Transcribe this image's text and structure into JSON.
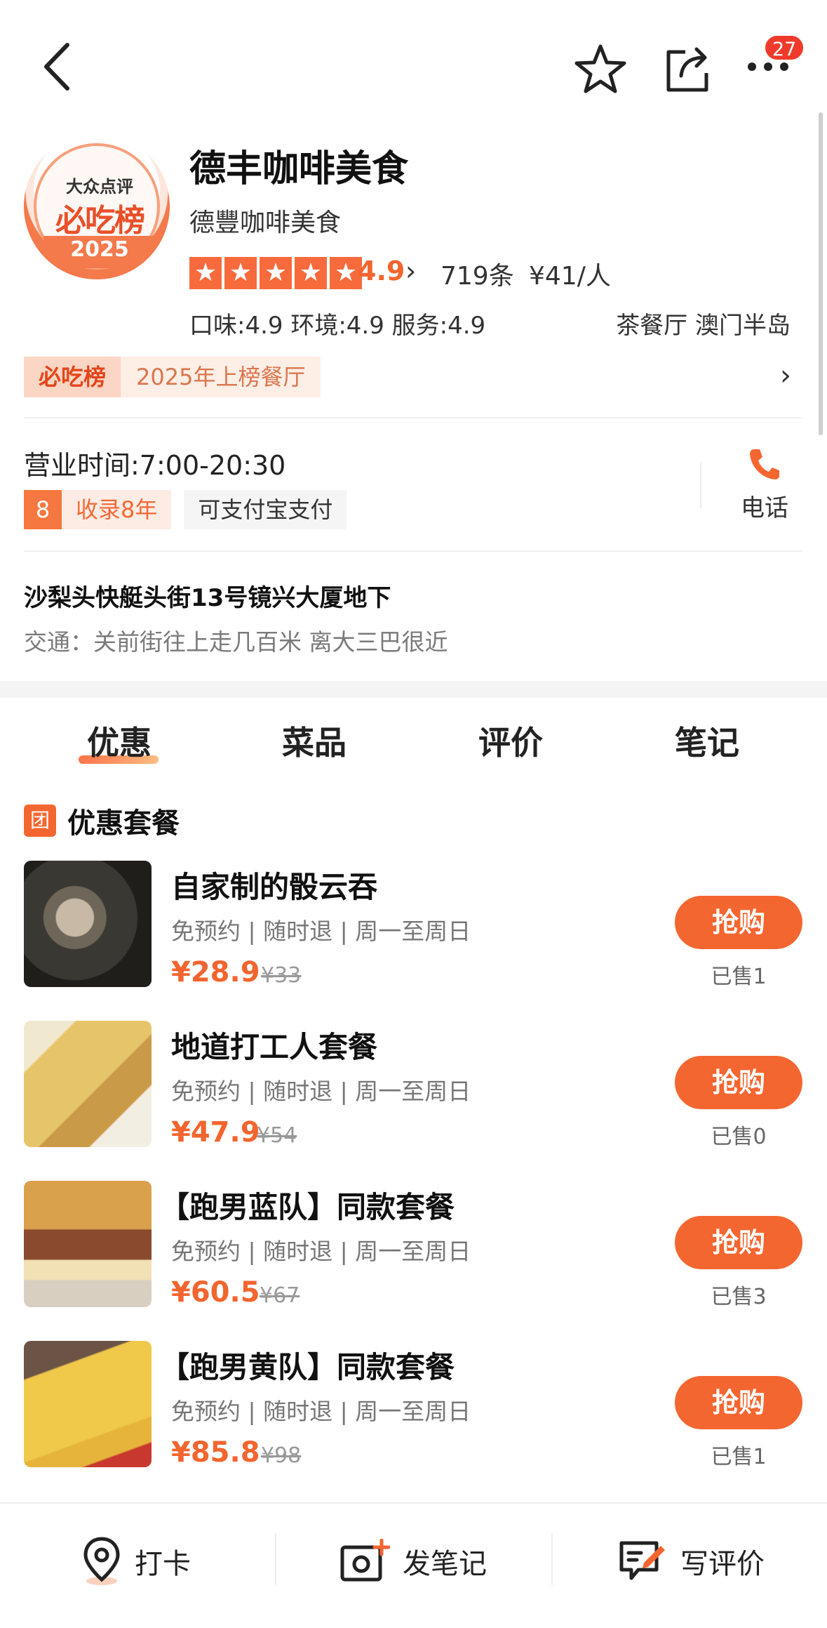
{
  "topbar": {
    "back_icon": "chevron-left-icon",
    "favorite_icon": "star-outline-icon",
    "share_icon": "share-icon",
    "more_icon": "more-dots-icon",
    "notification_count": "27"
  },
  "shop": {
    "logo_top_text": "大众点评",
    "logo_mid_text": "必吃榜",
    "logo_year": "2025",
    "name": "德丰咖啡美食",
    "alt_name": "德豐咖啡美食",
    "rating_stars": 5,
    "score": "4.9",
    "review_count": "719条",
    "avg_price": "¥41/人",
    "sub_scores": "口味:4.9 环境:4.9 服务:4.9",
    "category_area": "茶餐厅 澳门半岛",
    "rank_badge": "必吃榜",
    "rank_text": "2025年上榜餐厅"
  },
  "info": {
    "hours": "营业时间:7:00-20:30",
    "years_num": "8",
    "years_text": "收录8年",
    "pay_tag": "可支付宝支付",
    "phone_label": "电话",
    "address": "沙梨头快艇头街13号镜兴大厦地下",
    "traffic": "交通：关前街往上走几百米 离大三巴很近"
  },
  "tabs": [
    "优惠",
    "菜品",
    "评价",
    "笔记"
  ],
  "section": {
    "icon_text": "团",
    "title": "优惠套餐"
  },
  "deals": [
    {
      "name": "自家制的骰云吞",
      "meta": "免预约 | 随时退 | 周一至周日",
      "price": "¥28.9",
      "orig": "¥33",
      "button": "抢购",
      "sold": "已售1"
    },
    {
      "name": "地道打工人套餐",
      "meta": "免预约 | 随时退 | 周一至周日",
      "price": "¥47.9",
      "orig": "¥54",
      "button": "抢购",
      "sold": "已售0"
    },
    {
      "name": "【跑男蓝队】同款套餐",
      "meta": "免预约 | 随时退 | 周一至周日",
      "price": "¥60.5",
      "orig": "¥67",
      "button": "抢购",
      "sold": "已售3"
    },
    {
      "name": "【跑男黄队】同款套餐",
      "meta": "免预约 | 随时退 | 周一至周日",
      "price": "¥85.8",
      "orig": "¥98",
      "button": "抢购",
      "sold": "已售1"
    }
  ],
  "bottom_bar": {
    "checkin": "打卡",
    "post_note": "发笔记",
    "write_review": "写评价"
  },
  "colors": {
    "accent": "#f4662f",
    "price": "#f2652e",
    "badge": "#f03a2a"
  }
}
